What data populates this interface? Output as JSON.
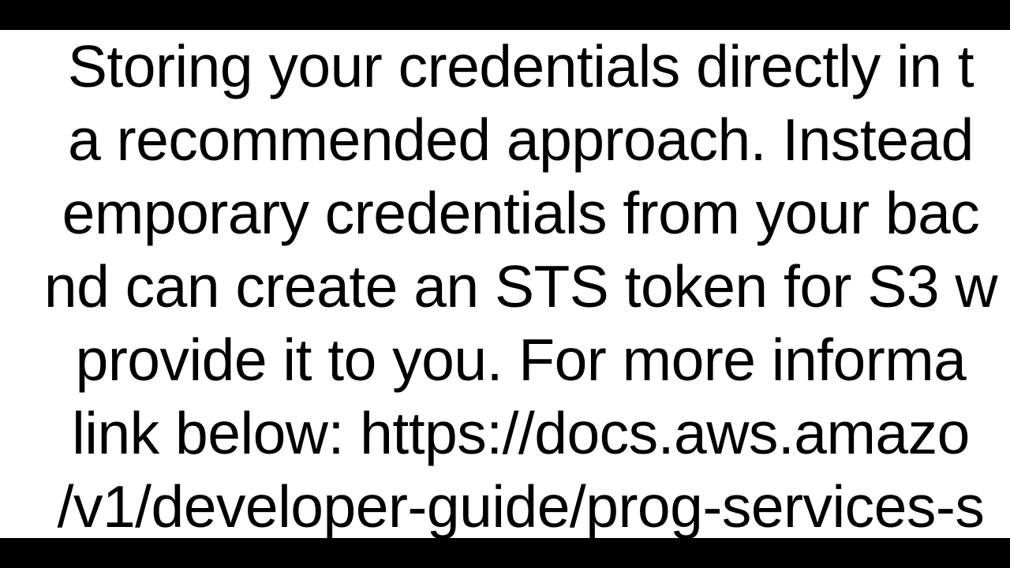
{
  "document": {
    "line1": " Storing your credentials directly in t",
    "line2": "a recommended approach. Instead",
    "line3": "emporary credentials from your bac",
    "line4": "nd can create an STS token for S3 w",
    "line5": " provide it to you. For more informa",
    "line6": " link below: https://docs.aws.amazo",
    "line7": "/v1/developer-guide/prog-services-s"
  }
}
